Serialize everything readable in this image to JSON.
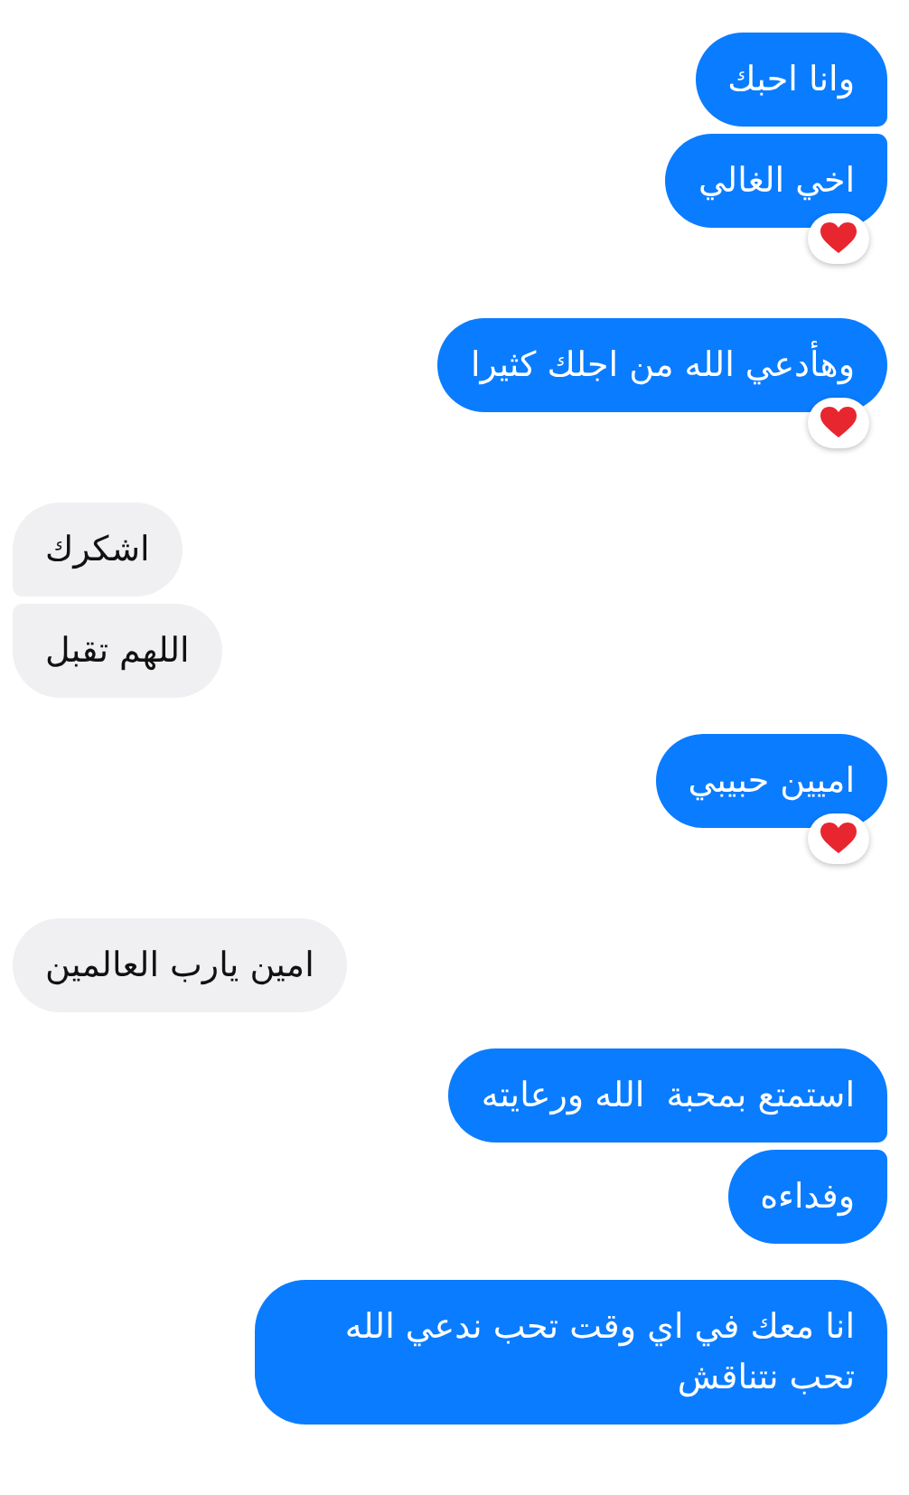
{
  "groups": [
    {
      "kind": "sent",
      "messages": [
        {
          "text": "وانا احبك",
          "reaction": false
        },
        {
          "text": "اخي الغالي",
          "reaction": true
        }
      ]
    },
    {
      "kind": "sent",
      "messages": [
        {
          "text": "وهأدعي الله من اجلك كثيرا",
          "reaction": true
        }
      ]
    },
    {
      "kind": "received",
      "messages": [
        {
          "text": "اشكرك",
          "reaction": false
        },
        {
          "text": "اللهم تقبل",
          "reaction": false
        }
      ]
    },
    {
      "kind": "sent",
      "messages": [
        {
          "text": "اميين حبيبي",
          "reaction": true
        }
      ]
    },
    {
      "kind": "received",
      "messages": [
        {
          "text": "امين يارب العالمين",
          "reaction": false
        }
      ]
    },
    {
      "kind": "sent",
      "messages": [
        {
          "text": "استمتع بمحبة  الله ورعايته",
          "reaction": false
        },
        {
          "text": "وفداءه",
          "reaction": false
        }
      ]
    },
    {
      "kind": "sent",
      "messages": [
        {
          "text": "انا معك في اي وقت تحب ندعي الله تحب نتناقش",
          "reaction": false
        }
      ]
    }
  ]
}
